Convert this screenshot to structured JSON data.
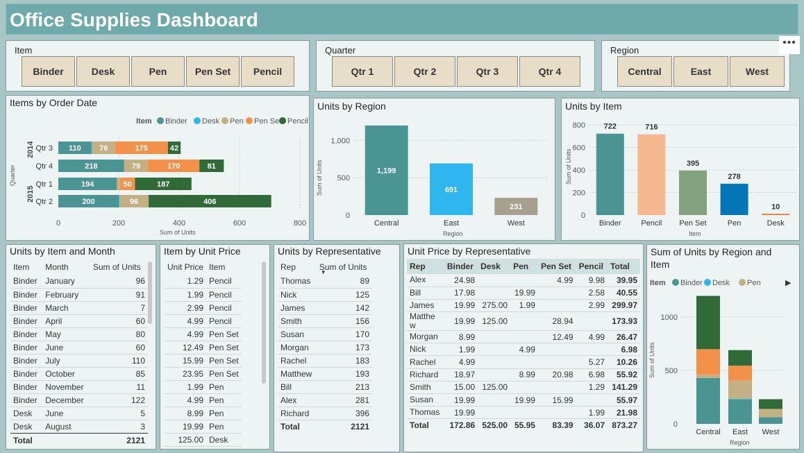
{
  "title": "Office Supplies Dashboard",
  "more": "•••",
  "slicers": {
    "item": {
      "title": "Item",
      "options": [
        "Binder",
        "Desk",
        "Pen",
        "Pen Set",
        "Pencil"
      ]
    },
    "quarter": {
      "title": "Quarter",
      "options": [
        "Qtr 1",
        "Qtr 2",
        "Qtr 3",
        "Qtr 4"
      ]
    },
    "region": {
      "title": "Region",
      "options": [
        "Central",
        "East",
        "West"
      ]
    }
  },
  "colors": {
    "Binder": "#4b9494",
    "Desk": "#2fb6ef",
    "Pen": "#c4b183",
    "Pen Set": "#f2914a",
    "Pencil": "#2f6a37",
    "West": "#a6a08e",
    "PencilLight": "#f6b88f",
    "PenSetGreen": "#83a07f",
    "PenBlue": "#0476b8",
    "DeskOrange": "#e06a2a"
  },
  "items_by_order_date": {
    "title": "Items by Order Date",
    "legend_label": "Item",
    "legend": [
      "Binder",
      "Desk",
      "Pen",
      "Pen Set",
      "Pencil"
    ],
    "ylabel": "Quarter",
    "xlabel": "Sum of Units",
    "years": [
      "2014",
      "2015"
    ],
    "xticks": [
      "0",
      "200",
      "400",
      "600",
      "800"
    ],
    "chart_data": {
      "type": "bar",
      "orientation": "horizontal",
      "stacked": true,
      "xlim": [
        0,
        800
      ],
      "categories": [
        {
          "year": "2014",
          "quarter": "Qtr 3"
        },
        {
          "year": "2014",
          "quarter": "Qtr 4"
        },
        {
          "year": "2015",
          "quarter": "Qtr 1"
        },
        {
          "year": "2015",
          "quarter": "Qtr 2"
        }
      ],
      "series": [
        {
          "name": "Binder",
          "values": [
            110,
            218,
            194,
            200
          ],
          "labels": [
            "110",
            "218",
            "194",
            "200"
          ]
        },
        {
          "name": "Desk",
          "values": [
            2,
            0,
            0,
            3
          ],
          "labels": [
            "",
            "",
            "",
            ""
          ]
        },
        {
          "name": "Pen",
          "values": [
            76,
            79,
            10,
            96
          ],
          "labels": [
            "76",
            "79",
            "",
            "96"
          ]
        },
        {
          "name": "Pen Set",
          "values": [
            175,
            170,
            50,
            0
          ],
          "labels": [
            "175",
            "170",
            "50",
            ""
          ]
        },
        {
          "name": "Pencil",
          "values": [
            42,
            81,
            187,
            406
          ],
          "labels": [
            "42",
            "81",
            "187",
            "406"
          ]
        }
      ]
    }
  },
  "units_by_region": {
    "title": "Units by Region",
    "ylabel": "Sum of Units",
    "xlabel": "Region",
    "yticks": [
      "0",
      "500",
      "1,000"
    ],
    "chart_data": {
      "type": "bar",
      "categories": [
        "Central",
        "East",
        "West"
      ],
      "values": [
        1199,
        691,
        231
      ],
      "labels": [
        "1,199",
        "691",
        "231"
      ],
      "ylim": [
        0,
        1300
      ]
    }
  },
  "units_by_item": {
    "title": "Units by Item",
    "ylabel": "Sum of Units",
    "xlabel": "Item",
    "yticks": [
      "0",
      "200",
      "400",
      "600",
      "800"
    ],
    "chart_data": {
      "type": "bar",
      "categories": [
        "Binder",
        "Pencil",
        "Pen Set",
        "Pen",
        "Desk"
      ],
      "values": [
        722,
        716,
        395,
        278,
        10
      ],
      "labels": [
        "722",
        "716",
        "395",
        "278",
        "10"
      ],
      "ylim": [
        0,
        800
      ]
    }
  },
  "units_by_item_month": {
    "title": "Units by Item and Month",
    "columns": [
      "Item",
      "Month",
      "Sum of Units"
    ],
    "rows": [
      [
        "Binder",
        "January",
        "96"
      ],
      [
        "Binder",
        "February",
        "91"
      ],
      [
        "Binder",
        "March",
        "7"
      ],
      [
        "Binder",
        "April",
        "60"
      ],
      [
        "Binder",
        "May",
        "80"
      ],
      [
        "Binder",
        "June",
        "60"
      ],
      [
        "Binder",
        "July",
        "110"
      ],
      [
        "Binder",
        "October",
        "85"
      ],
      [
        "Binder",
        "November",
        "11"
      ],
      [
        "Binder",
        "December",
        "122"
      ],
      [
        "Desk",
        "June",
        "5"
      ],
      [
        "Desk",
        "August",
        "3"
      ]
    ],
    "total": [
      "Total",
      "",
      "2121"
    ]
  },
  "item_by_unit_price": {
    "title": "Item by Unit Price",
    "columns": [
      "Unit Price",
      "Item"
    ],
    "rows": [
      [
        "1.29",
        "Pencil"
      ],
      [
        "1.99",
        "Pencil"
      ],
      [
        "2.99",
        "Pencil"
      ],
      [
        "4.99",
        "Pencil"
      ],
      [
        "4.99",
        "Pen Set"
      ],
      [
        "12.49",
        "Pen Set"
      ],
      [
        "15.99",
        "Pen Set"
      ],
      [
        "23.95",
        "Pen Set"
      ],
      [
        "1.99",
        "Pen"
      ],
      [
        "4.99",
        "Pen"
      ],
      [
        "8.99",
        "Pen"
      ],
      [
        "19.99",
        "Pen"
      ],
      [
        "125.00",
        "Desk"
      ]
    ]
  },
  "units_by_rep": {
    "title": "Units by Representative",
    "columns": [
      "Rep",
      "Sum of Units"
    ],
    "rows": [
      [
        "Thomas",
        "89"
      ],
      [
        "Nick",
        "125"
      ],
      [
        "James",
        "142"
      ],
      [
        "Smith",
        "156"
      ],
      [
        "Susan",
        "170"
      ],
      [
        "Morgan",
        "173"
      ],
      [
        "Rachel",
        "183"
      ],
      [
        "Matthew",
        "193"
      ],
      [
        "Bill",
        "213"
      ],
      [
        "Alex",
        "281"
      ],
      [
        "Richard",
        "396"
      ]
    ],
    "total": [
      "Total",
      "2121"
    ]
  },
  "unit_price_by_rep": {
    "title": "Unit Price by Representative",
    "columns": [
      "Rep",
      "Binder",
      "Desk",
      "Pen",
      "Pen Set",
      "Pencil",
      "Total"
    ],
    "rows": [
      [
        "Alex",
        "24.98",
        "",
        "",
        "4.99",
        "9.98",
        "39.95"
      ],
      [
        "Bill",
        "17.98",
        "",
        "19.99",
        "",
        "2.58",
        "40.55"
      ],
      [
        "James",
        "19.99",
        "275.00",
        "1.99",
        "",
        "2.99",
        "299.97"
      ],
      [
        "Matthe\nw",
        "19.99",
        "125.00",
        "",
        "28.94",
        "",
        "173.93"
      ],
      [
        "Morgan",
        "8.99",
        "",
        "",
        "12.49",
        "4.99",
        "26.47"
      ],
      [
        "Nick",
        "1.99",
        "",
        "4.99",
        "",
        "",
        "6.98"
      ],
      [
        "Rachel",
        "4.99",
        "",
        "",
        "",
        "5.27",
        "10.26"
      ],
      [
        "Richard",
        "18.97",
        "",
        "8.99",
        "20.98",
        "6.98",
        "55.92"
      ],
      [
        "Smith",
        "15.00",
        "125.00",
        "",
        "",
        "1.29",
        "141.29"
      ],
      [
        "Susan",
        "19.99",
        "",
        "19.99",
        "15.99",
        "",
        "55.97"
      ],
      [
        "Thomas",
        "19.99",
        "",
        "",
        "",
        "1.99",
        "21.98"
      ]
    ],
    "total": [
      "Total",
      "172.86",
      "525.00",
      "55.95",
      "83.39",
      "36.07",
      "873.27"
    ]
  },
  "sum_units_region_item": {
    "title": "Sum of Units by Region and Item",
    "legend_label": "Item",
    "legend": [
      "Binder",
      "Desk",
      "Pen"
    ],
    "ylabel": "Sum of Units",
    "xlabel": "Region",
    "yticks": [
      "0",
      "500",
      "1000"
    ],
    "chart_data": {
      "type": "bar",
      "stacked": true,
      "categories": [
        "Central",
        "East",
        "West"
      ],
      "ylim": [
        0,
        1300
      ],
      "series": [
        {
          "name": "Binder",
          "values": [
            430,
            230,
            62
          ]
        },
        {
          "name": "Desk",
          "values": [
            0,
            5,
            0
          ]
        },
        {
          "name": "Pen",
          "values": [
            30,
            170,
            78
          ]
        },
        {
          "name": "Pen Set",
          "values": [
            240,
            140,
            0
          ]
        },
        {
          "name": "Pencil",
          "values": [
            499,
            146,
            91
          ]
        }
      ]
    }
  }
}
